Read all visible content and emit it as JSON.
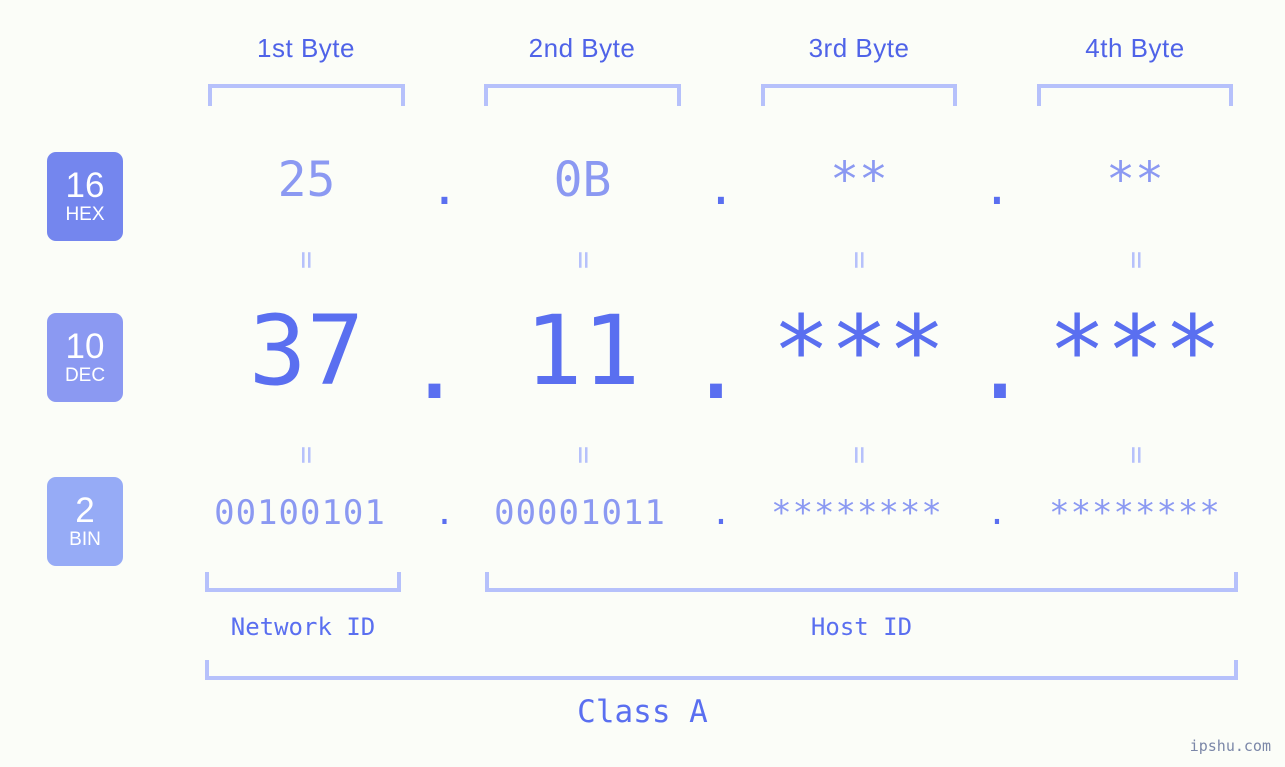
{
  "meta": {
    "background_color": "#fbfdf8",
    "accent_strong": "#5a6ff0",
    "accent_mid": "#8b99f2",
    "accent_light": "#b6c1fb",
    "watermark": "ipshu.com"
  },
  "headers": [
    {
      "label": "1st Byte"
    },
    {
      "label": "2nd Byte"
    },
    {
      "label": "3rd Byte"
    },
    {
      "label": "4th Byte"
    }
  ],
  "radix_badges": [
    {
      "number": "16",
      "name": "HEX",
      "color": "#7486ee"
    },
    {
      "number": "10",
      "name": "DEC",
      "color": "#8b99f2"
    },
    {
      "number": "2",
      "name": "BIN",
      "color": "#96abf6"
    }
  ],
  "rows": {
    "hex": {
      "values": [
        "25",
        "0B",
        "**",
        "**"
      ],
      "separator": "."
    },
    "dec": {
      "values": [
        "37",
        "11",
        "***",
        "***"
      ],
      "separator": "."
    },
    "bin": {
      "values": [
        "00100101",
        "00001011",
        "********",
        "********"
      ],
      "separator": "."
    }
  },
  "equal_marks": {
    "hex_to_dec": [
      "=",
      "=",
      "=",
      "="
    ],
    "dec_to_bin": [
      "=",
      "=",
      "=",
      "="
    ]
  },
  "id_labels": [
    {
      "label": "Network ID"
    },
    {
      "label": "Host ID"
    }
  ],
  "class_label": "Class A"
}
